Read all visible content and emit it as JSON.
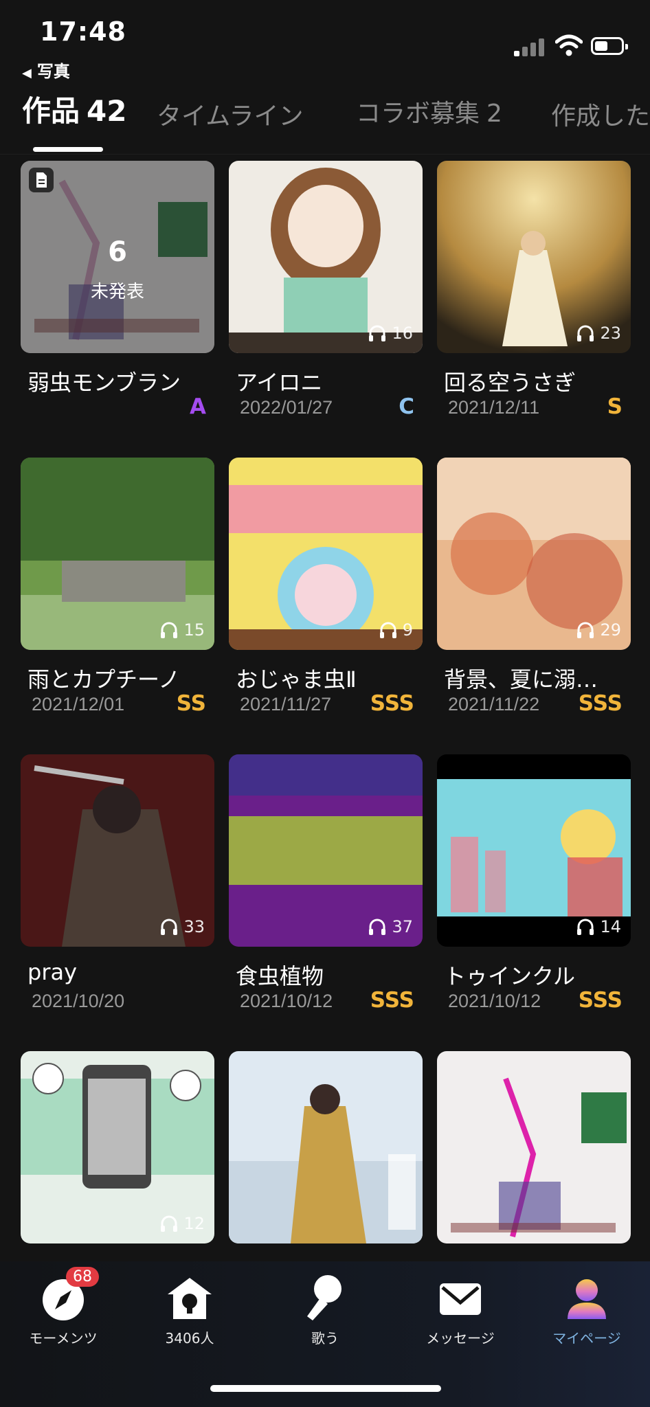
{
  "status": {
    "time": "17:48",
    "back_label": "写真"
  },
  "tabs": [
    {
      "label": "作品",
      "count": "42"
    },
    {
      "label": "タイムライン",
      "count": ""
    },
    {
      "label": "コラボ募集",
      "count": "2"
    },
    {
      "label": "作成した",
      "count": ""
    }
  ],
  "works": [
    {
      "title": "弱虫モンブラン",
      "date": "",
      "plays": "",
      "rank": "A",
      "unreleased_count": "6",
      "unreleased_label": "未発表"
    },
    {
      "title": "アイロニ",
      "date": "2022/01/27",
      "plays": "16",
      "rank": "C"
    },
    {
      "title": "回る空うさぎ",
      "date": "2021/12/11",
      "plays": "23",
      "rank": "S"
    },
    {
      "title": "雨とカプチーノ",
      "date": "2021/12/01",
      "plays": "15",
      "rank": "SS"
    },
    {
      "title": "おじゃま虫Ⅱ",
      "date": "2021/11/27",
      "plays": "9",
      "rank": "SSS"
    },
    {
      "title": "背景、夏に溺…",
      "date": "2021/11/22",
      "plays": "29",
      "rank": "SSS"
    },
    {
      "title": "pray",
      "date": "2021/10/20",
      "plays": "33",
      "rank": ""
    },
    {
      "title": "食虫植物",
      "date": "2021/10/12",
      "plays": "37",
      "rank": "SSS"
    },
    {
      "title": "トゥインクル",
      "date": "2021/10/12",
      "plays": "14",
      "rank": "SSS"
    },
    {
      "title": "",
      "date": "",
      "plays": "12",
      "rank": ""
    },
    {
      "title": "",
      "date": "",
      "plays": "",
      "rank": ""
    },
    {
      "title": "",
      "date": "",
      "plays": "",
      "rank": ""
    }
  ],
  "rank_colors": {
    "A": "#a44cf0",
    "C": "#8fc3ee",
    "S": "#f1b43a",
    "SS": "#f1b43a",
    "SSS": "#f1b43a"
  },
  "nav": [
    {
      "label": "モーメンツ",
      "badge": "68",
      "icon": "compass-icon"
    },
    {
      "label": "3406人",
      "icon": "lightbulb-house-icon"
    },
    {
      "label": "歌う",
      "icon": "microphone-icon"
    },
    {
      "label": "メッセージ",
      "icon": "envelope-icon"
    },
    {
      "label": "マイページ",
      "icon": "profile-icon"
    }
  ]
}
